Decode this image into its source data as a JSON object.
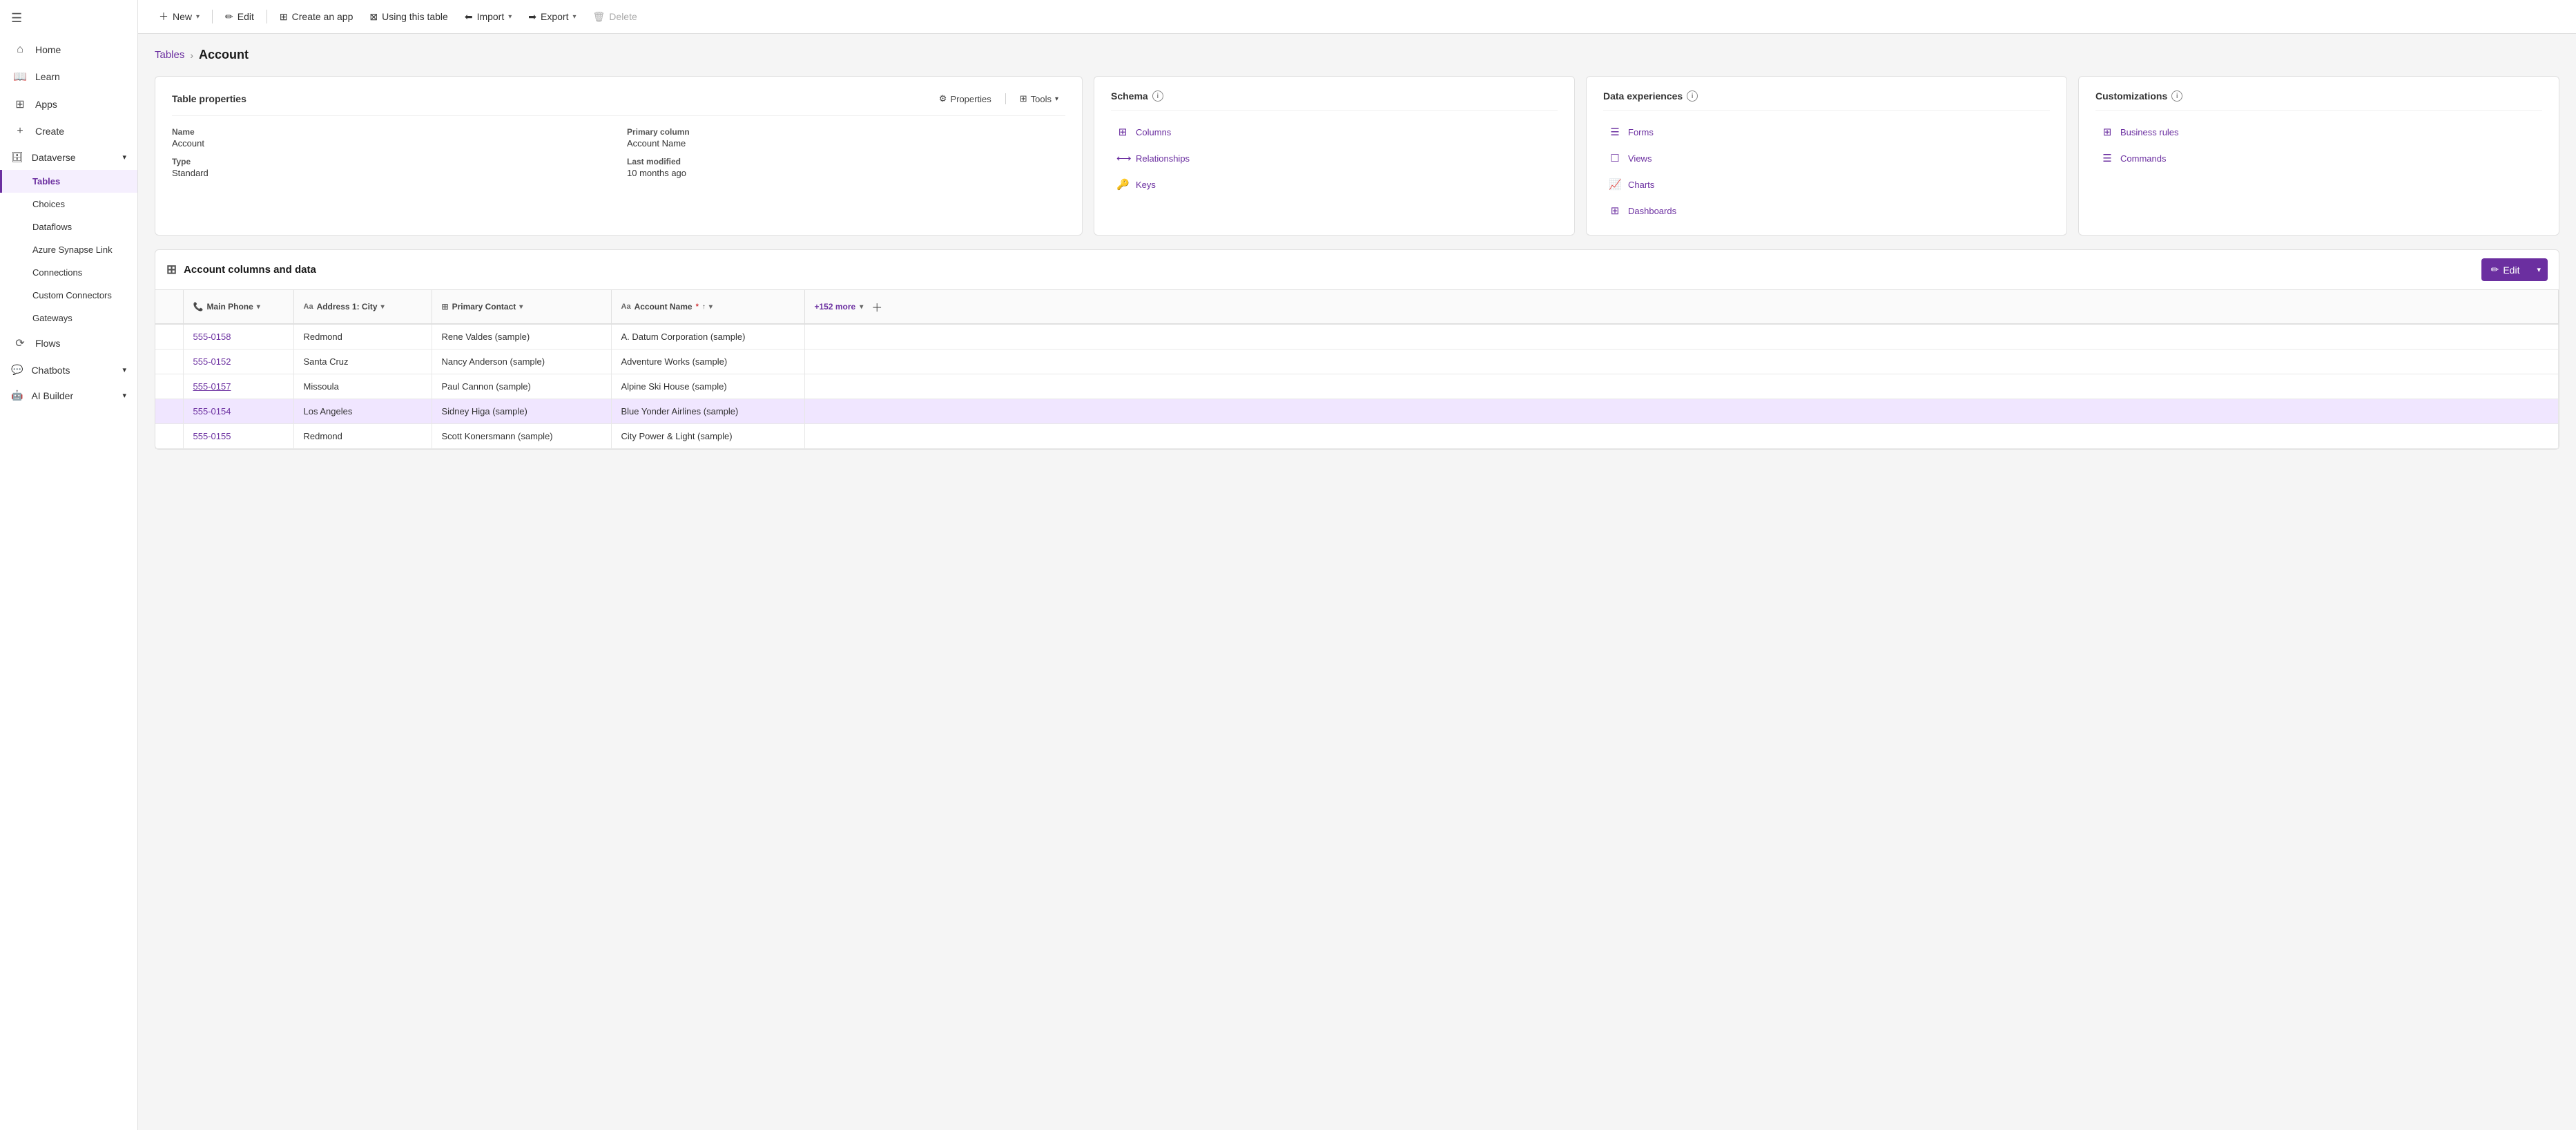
{
  "sidebar": {
    "items": [
      {
        "id": "home",
        "label": "Home",
        "icon": "⌂"
      },
      {
        "id": "learn",
        "label": "Learn",
        "icon": "📖"
      },
      {
        "id": "apps",
        "label": "Apps",
        "icon": "⊞"
      },
      {
        "id": "create",
        "label": "Create",
        "icon": "+"
      }
    ],
    "dataverse": {
      "label": "Dataverse",
      "icon": "🗄",
      "subitems": [
        {
          "id": "tables",
          "label": "Tables",
          "active": true
        },
        {
          "id": "choices",
          "label": "Choices"
        },
        {
          "id": "dataflows",
          "label": "Dataflows"
        },
        {
          "id": "azure-synapse",
          "label": "Azure Synapse Link"
        },
        {
          "id": "connections",
          "label": "Connections"
        },
        {
          "id": "custom-connectors",
          "label": "Custom Connectors"
        },
        {
          "id": "gateways",
          "label": "Gateways"
        }
      ]
    },
    "flows": {
      "label": "Flows",
      "icon": "⟳"
    },
    "chatbots": {
      "label": "Chatbots",
      "icon": "💬"
    },
    "ai_builder": {
      "label": "AI Builder",
      "icon": "🤖"
    }
  },
  "toolbar": {
    "new_label": "New",
    "edit_label": "Edit",
    "create_app_label": "Create an app",
    "using_table_label": "Using this table",
    "import_label": "Import",
    "export_label": "Export",
    "delete_label": "Delete"
  },
  "breadcrumb": {
    "tables_label": "Tables",
    "separator": "›",
    "current": "Account"
  },
  "table_properties_card": {
    "title": "Table properties",
    "properties_btn": "Properties",
    "tools_btn": "Tools",
    "name_label": "Name",
    "name_value": "Account",
    "type_label": "Type",
    "type_value": "Standard",
    "primary_column_label": "Primary column",
    "primary_column_value": "Account Name",
    "last_modified_label": "Last modified",
    "last_modified_value": "10 months ago"
  },
  "schema_card": {
    "title": "Schema",
    "items": [
      {
        "id": "columns",
        "label": "Columns",
        "icon": "⊞"
      },
      {
        "id": "relationships",
        "label": "Relationships",
        "icon": "⟷"
      },
      {
        "id": "keys",
        "label": "Keys",
        "icon": "🔑"
      }
    ]
  },
  "data_experiences_card": {
    "title": "Data experiences",
    "items": [
      {
        "id": "forms",
        "label": "Forms",
        "icon": "☰"
      },
      {
        "id": "views",
        "label": "Views",
        "icon": "☐"
      },
      {
        "id": "charts",
        "label": "Charts",
        "icon": "📈"
      },
      {
        "id": "dashboards",
        "label": "Dashboards",
        "icon": "⊞"
      }
    ]
  },
  "customizations_card": {
    "title": "Customizations",
    "items": [
      {
        "id": "business-rules",
        "label": "Business rules",
        "icon": "⊞"
      },
      {
        "id": "commands",
        "label": "Commands",
        "icon": "☰"
      }
    ]
  },
  "columns_section": {
    "title": "Account columns and data",
    "edit_label": "Edit",
    "columns": [
      {
        "id": "main-phone",
        "label": "Main Phone",
        "icon": "📞"
      },
      {
        "id": "address-city",
        "label": "Address 1: City",
        "icon": "Aa"
      },
      {
        "id": "primary-contact",
        "label": "Primary Contact",
        "icon": "⊞"
      },
      {
        "id": "account-name",
        "label": "Account Name",
        "icon": "Aa",
        "required": true,
        "sortable": true
      }
    ],
    "more_label": "+152 more",
    "rows": [
      {
        "phone": "555-0158",
        "phone_link": true,
        "city": "Redmond",
        "contact": "Rene Valdes (sample)",
        "account": "A. Datum Corporation (sample)",
        "selected": false
      },
      {
        "phone": "555-0152",
        "phone_link": true,
        "city": "Santa Cruz",
        "contact": "Nancy Anderson (sample)",
        "account": "Adventure Works (sample)",
        "selected": false
      },
      {
        "phone": "555-0157",
        "phone_link": true,
        "phone_underline": true,
        "city": "Missoula",
        "contact": "Paul Cannon (sample)",
        "account": "Alpine Ski House (sample)",
        "selected": false
      },
      {
        "phone": "555-0154",
        "phone_link": true,
        "city": "Los Angeles",
        "contact": "Sidney Higa (sample)",
        "account": "Blue Yonder Airlines (sample)",
        "selected": true
      },
      {
        "phone": "555-0155",
        "phone_link": true,
        "city": "Redmond",
        "contact": "Scott Konersmann (sample)",
        "account": "City Power & Light (sample)",
        "selected": false
      }
    ]
  },
  "colors": {
    "accent": "#6b2fa0",
    "accent_light": "#f5effe"
  }
}
